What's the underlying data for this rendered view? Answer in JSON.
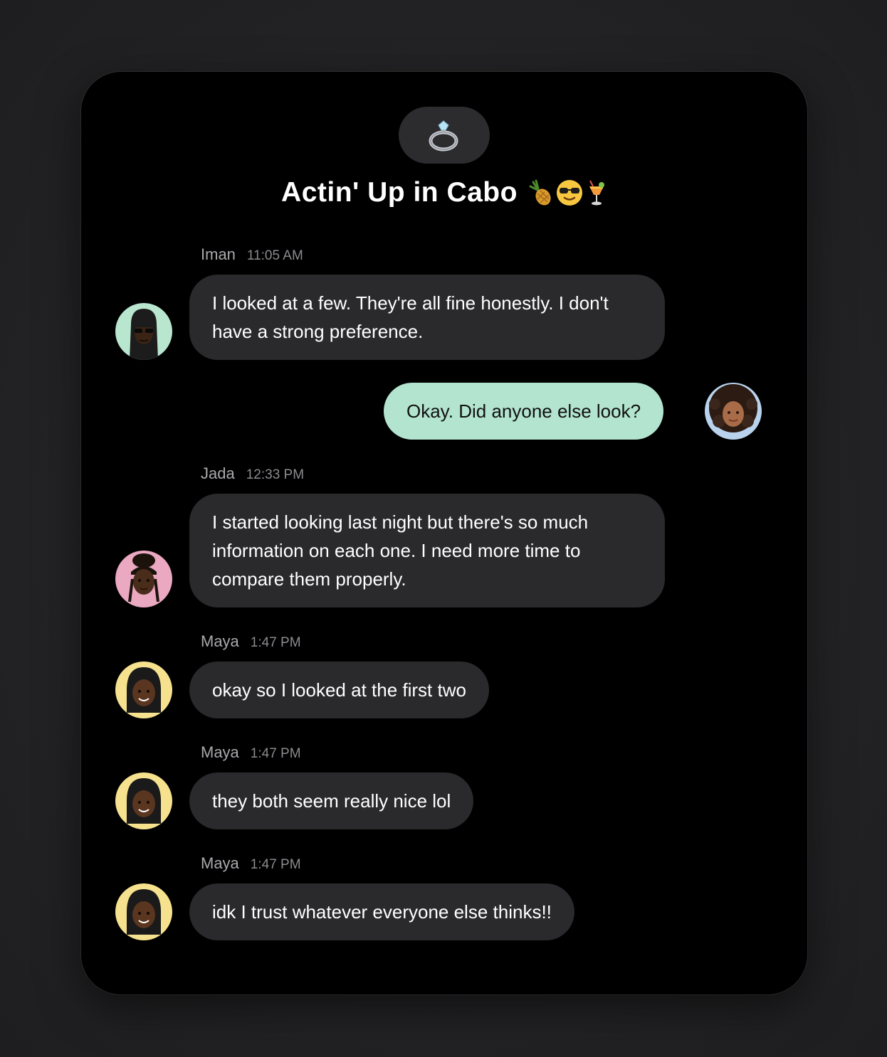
{
  "chat": {
    "group_icon": "ring-icon",
    "title": "Actin' Up in Cabo",
    "title_emojis": [
      "pineapple-icon",
      "sunglasses-face-icon",
      "tropical-drink-icon"
    ],
    "messages": [
      {
        "sender": "Iman",
        "time": "11:05 AM",
        "text": "I looked at a few. They're all fine honestly. I don't have a strong preference.",
        "avatar_bg": "#b8e6cf"
      },
      {
        "sender": "me",
        "time": "",
        "text": "Okay. Did anyone else look?",
        "avatar_bg": "#b9d3ee"
      },
      {
        "sender": "Jada",
        "time": "12:33 PM",
        "text": "I started looking last night but there's so much information on each one. I need more time to compare them properly.",
        "avatar_bg": "#eaa8c1"
      },
      {
        "sender": "Maya",
        "time": "1:47 PM",
        "text": "okay so I looked at the first two",
        "avatar_bg": "#f6e28e"
      },
      {
        "sender": "Maya",
        "time": "1:47 PM",
        "text": "they both seem really nice lol",
        "avatar_bg": "#f6e28e"
      },
      {
        "sender": "Maya",
        "time": "1:47 PM",
        "text": "idk I trust whatever everyone else thinks!!",
        "avatar_bg": "#f6e28e"
      }
    ]
  },
  "colors": {
    "page_bg": "#232325",
    "card_bg": "#000000",
    "incoming_bubble": "#2a2a2d",
    "outgoing_bubble": "#b3e4cf"
  }
}
